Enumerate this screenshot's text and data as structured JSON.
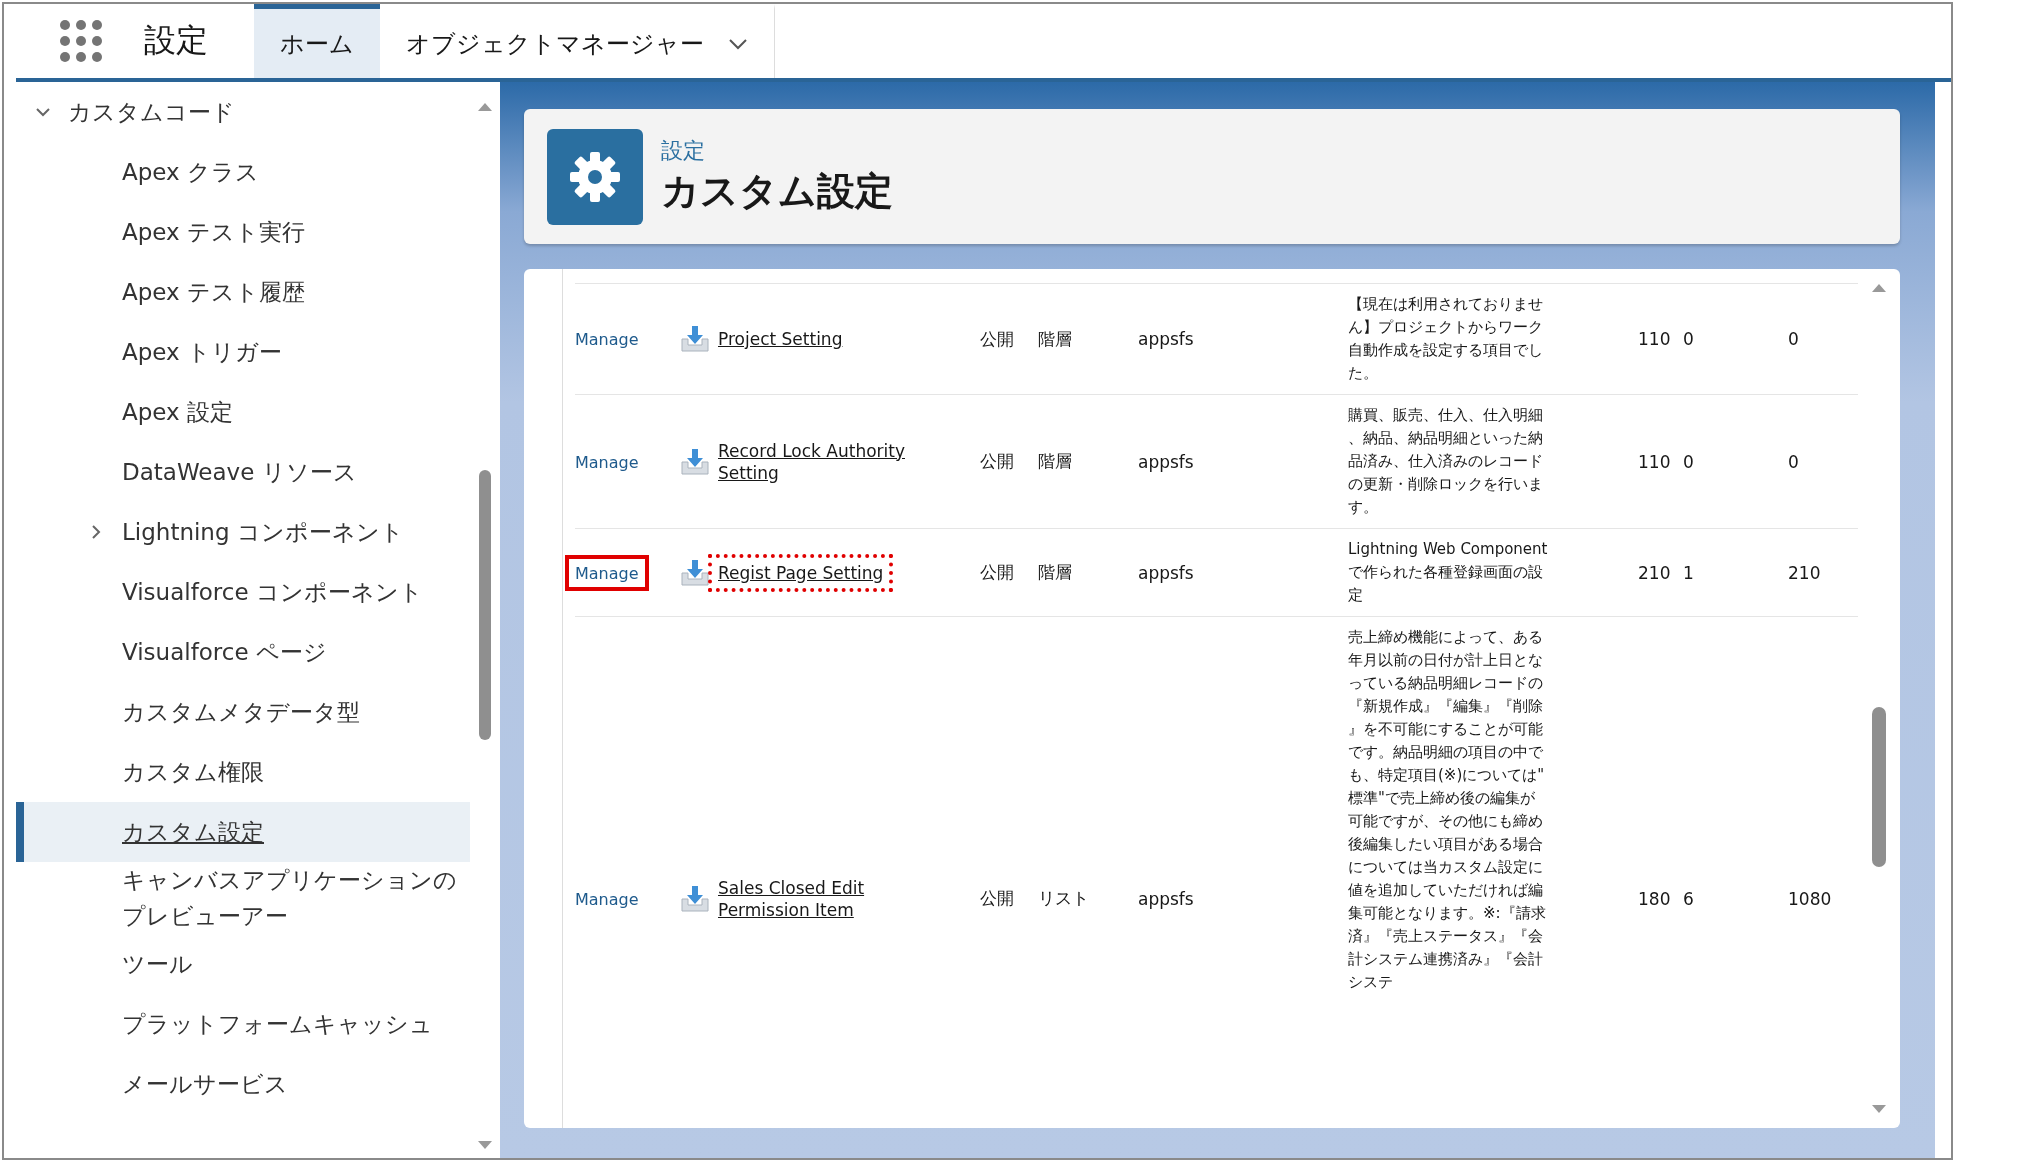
{
  "header": {
    "app_name": "設定",
    "tabs": [
      {
        "label": "ホーム",
        "selected": true,
        "dropdown": false
      },
      {
        "label": "オブジェクトマネージャー",
        "selected": false,
        "dropdown": true
      }
    ]
  },
  "sidebar": {
    "items": [
      {
        "label": "カスタムコード",
        "expanded": true,
        "children": [
          {
            "label": "Apex クラス",
            "kind": "page",
            "selected": false
          },
          {
            "label": "Apex テスト実行",
            "kind": "page",
            "selected": false
          },
          {
            "label": "Apex テスト履歴",
            "kind": "page",
            "selected": false
          },
          {
            "label": "Apex トリガー",
            "kind": "page",
            "selected": false
          },
          {
            "label": "Apex 設定",
            "kind": "page",
            "selected": false
          },
          {
            "label": "DataWeave リソース",
            "kind": "page",
            "selected": false
          },
          {
            "label": "Lightning コンポーネント",
            "kind": "folder",
            "expanded": false,
            "selected": false
          },
          {
            "label": "Visualforce コンポーネント",
            "kind": "page",
            "selected": false
          },
          {
            "label": "Visualforce ページ",
            "kind": "page",
            "selected": false
          },
          {
            "label": "カスタムメタデータ型",
            "kind": "page",
            "selected": false
          },
          {
            "label": "カスタム権限",
            "kind": "page",
            "selected": false
          },
          {
            "label": "カスタム設定",
            "kind": "page",
            "selected": true
          },
          {
            "label": "キャンバスアプリケーションのプレビューアー",
            "kind": "page",
            "selected": false
          },
          {
            "label": "ツール",
            "kind": "page",
            "selected": false
          },
          {
            "label": "プラットフォームキャッシュ",
            "kind": "page",
            "selected": false
          },
          {
            "label": "メールサービス",
            "kind": "page",
            "selected": false
          }
        ]
      }
    ]
  },
  "page_header": {
    "breadcrumb": "設定",
    "title": "カスタム設定"
  },
  "table": {
    "rows": [
      {
        "manage": "Manage",
        "name": "Project Setting",
        "visibility": "公開",
        "setting_type": "階層",
        "namespace": "appsfs",
        "description": "【現在は利用されておりません】プロジェクトからワーク自動作成を設定する項目でした。",
        "column_7": "110",
        "column_8": "0",
        "column_9": "0",
        "manage_highlighted": false,
        "name_highlighted": false
      },
      {
        "manage": "Manage",
        "name": "Record Lock Authority Setting",
        "visibility": "公開",
        "setting_type": "階層",
        "namespace": "appsfs",
        "description": "購買、販売、仕入、仕入明細、納品、納品明細といった納品済み、仕入済みのレコードの更新・削除ロックを行います。",
        "column_7": "110",
        "column_8": "0",
        "column_9": "0",
        "manage_highlighted": false,
        "name_highlighted": false
      },
      {
        "manage": "Manage",
        "name": "Regist Page Setting",
        "visibility": "公開",
        "setting_type": "階層",
        "namespace": "appsfs",
        "description": "Lightning Web Componentで作られた各種登録画面の設定",
        "column_7": "210",
        "column_8": "1",
        "column_9": "210",
        "manage_highlighted": true,
        "name_highlighted": true
      },
      {
        "manage": "Manage",
        "name": "Sales Closed Edit Permission Item",
        "visibility": "公開",
        "setting_type": "リスト",
        "namespace": "appsfs",
        "description": "売上締め機能によって、ある年月以前の日付が計上日となっている納品明細レコードの『新規作成』『編集』『削除』を不可能にすることが可能です。納品明細の項目の中でも、特定項目(※)については\"標準\"で売上締め後の編集が可能ですが、その他にも締め後編集したい項目がある場合については当カスタム設定に値を追加していただければ編集可能となります。※:『請求済』『売上ステータス』『会計システム連携済み』『会計システ",
        "column_7": "180",
        "column_8": "6",
        "column_9": "1080",
        "manage_highlighted": false,
        "name_highlighted": false
      }
    ]
  }
}
